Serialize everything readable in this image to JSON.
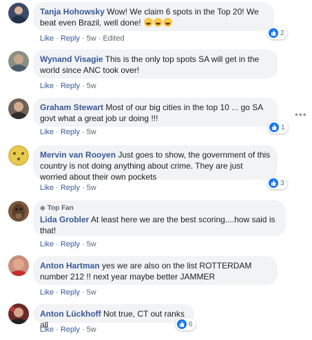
{
  "comments": [
    {
      "author": "Tanja Hohowsky",
      "text": "Wow! We claim 6 spots in the Top 20! We beat even Brazil, well done!",
      "emojis": [
        "laughing-emoji",
        "laughing-emoji",
        "laughing-emoji"
      ],
      "actions": {
        "like": "Like",
        "reply": "Reply",
        "time": "5w",
        "edited": "Edited"
      },
      "reactions": "2",
      "avatar_color": "#3b4a66"
    },
    {
      "author": "Wynand Visagie",
      "text": "This is the only top spots SA will get in the world since ANC took over!",
      "actions": {
        "like": "Like",
        "reply": "Reply",
        "time": "5w"
      },
      "avatar_color": "#8a8f86"
    },
    {
      "author": "Graham Stewart",
      "text": "Most of our big cities in the top 10 ... go SA govt what a great job ur doing !!!",
      "actions": {
        "like": "Like",
        "reply": "Reply",
        "time": "5w"
      },
      "reactions": "1",
      "avatar_color": "#6e6258"
    },
    {
      "author": "Mervin van Rooyen",
      "text": "Just goes to show, the government of this country is not doing anything about crime. They are just worried about their own pockets",
      "actions": {
        "like": "Like",
        "reply": "Reply",
        "time": "5w"
      },
      "reactions": "3",
      "avatar_color": "#d9b84a"
    },
    {
      "author": "Lida Grobler",
      "badge": "Top Fan",
      "text": "At least here we are the best scoring....how said is that!",
      "actions": {
        "like": "Like",
        "reply": "Reply",
        "time": "5w"
      },
      "avatar_color": "#7a5a3e"
    },
    {
      "author": "Anton Hartman",
      "text": "yes we are also on the list ROTTERDAM number 212 !! next year maybe better JAMMER",
      "actions": {
        "like": "Like",
        "reply": "Reply",
        "time": "5w"
      },
      "avatar_color": "#c98f7c"
    },
    {
      "author": "Anton Lückhoff",
      "text": "Not true, CT out ranks all",
      "actions": {
        "like": "Like",
        "reply": "Reply",
        "time": "5w"
      },
      "reactions": "6",
      "avatar_color": "#6b2a2a"
    }
  ],
  "colors": {
    "author_link": "#385898",
    "bubble_bg": "#f2f3f5",
    "like_blue": "#1877f2"
  },
  "icons": {
    "more": "more-options-icon",
    "like": "thumbs-up-icon",
    "badge": "diamond-icon"
  }
}
